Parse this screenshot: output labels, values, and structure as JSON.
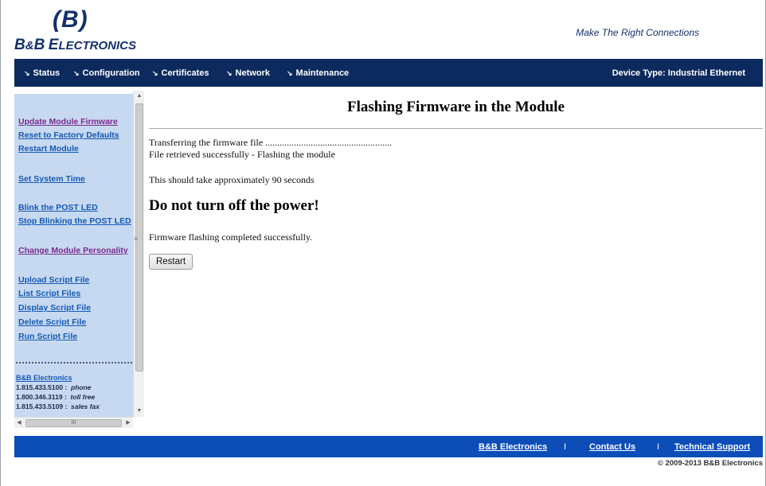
{
  "header": {
    "logo_mark": "(B)",
    "logo_b1": "B",
    "logo_amp": "&",
    "logo_b2": "B",
    "logo_e": "E",
    "logo_rest": "LECTRONICS",
    "tagline": "Make The Right Connections"
  },
  "nav": {
    "items": [
      {
        "label": "Status"
      },
      {
        "label": "Configuration"
      },
      {
        "label": "Certificates"
      },
      {
        "label": "Network"
      },
      {
        "label": "Maintenance"
      }
    ],
    "arrow_glyph": "↘",
    "device_type": "Device Type: Industrial Ethernet"
  },
  "sidebar": {
    "links": [
      {
        "label": "Update Module Firmware",
        "visited": true
      },
      {
        "label": "Reset to Factory Defaults",
        "visited": false
      },
      {
        "label": "Restart Module",
        "visited": false
      },
      {
        "label": "Set System Time",
        "visited": false
      },
      {
        "label": "Blink the POST LED",
        "visited": false
      },
      {
        "label": "Stop Blinking the POST LED",
        "visited": false
      },
      {
        "label": "Change Module Personality",
        "visited": true
      },
      {
        "label": "Upload Script File",
        "visited": false
      },
      {
        "label": "List Script Files",
        "visited": false
      },
      {
        "label": "Display Script File",
        "visited": false
      },
      {
        "label": "Delete Script File",
        "visited": false
      },
      {
        "label": "Run Script File",
        "visited": false
      }
    ],
    "contact": {
      "company": "B&B Electronics",
      "lines": [
        {
          "number": "1.815.433.5100 :",
          "label": "phone"
        },
        {
          "number": "1.800.346.3119 :",
          "label": "toll free"
        },
        {
          "number": "1.815.433.5109 :",
          "label": "sales fax"
        }
      ]
    },
    "scroll_grip": "≡",
    "hscroll_grip": "III"
  },
  "main": {
    "title": "Flashing Firmware in the Module",
    "transfer_text": "Transferring the firmware file .....................................................",
    "retrieved_text": "File retrieved successfully - Flashing the module",
    "duration_text": "This should take approximately 90 seconds",
    "warning": "Do not turn off the power!",
    "completed_text": "Firmware flashing completed successfully.",
    "restart_button": "Restart"
  },
  "footer": {
    "links": [
      "B&B Electronics",
      "Contact Us",
      "Technical Support"
    ],
    "separator": "I",
    "copyright": "© 2009-2013 B&B Electronics"
  }
}
